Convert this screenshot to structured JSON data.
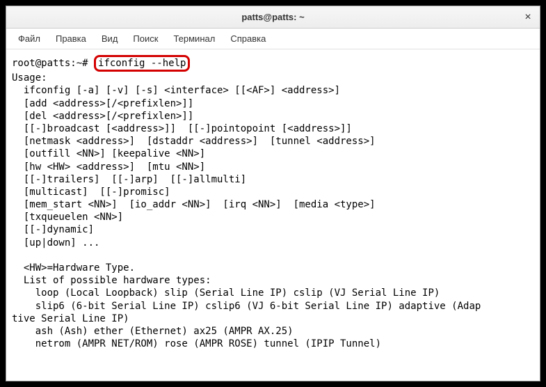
{
  "titlebar": {
    "title": "patts@patts: ~",
    "close_glyph": "×"
  },
  "menubar": {
    "items": [
      {
        "label": "Файл"
      },
      {
        "label": "Правка"
      },
      {
        "label": "Вид"
      },
      {
        "label": "Поиск"
      },
      {
        "label": "Терминал"
      },
      {
        "label": "Справка"
      }
    ]
  },
  "terminal": {
    "prompt": "root@patts:~# ",
    "command": "ifconfig --help",
    "output_lines": [
      "Usage:",
      "  ifconfig [-a] [-v] [-s] <interface> [[<AF>] <address>]",
      "  [add <address>[/<prefixlen>]]",
      "  [del <address>[/<prefixlen>]]",
      "  [[-]broadcast [<address>]]  [[-]pointopoint [<address>]]",
      "  [netmask <address>]  [dstaddr <address>]  [tunnel <address>]",
      "  [outfill <NN>] [keepalive <NN>]",
      "  [hw <HW> <address>]  [mtu <NN>]",
      "  [[-]trailers]  [[-]arp]  [[-]allmulti]",
      "  [multicast]  [[-]promisc]",
      "  [mem_start <NN>]  [io_addr <NN>]  [irq <NN>]  [media <type>]",
      "  [txqueuelen <NN>]",
      "  [[-]dynamic]",
      "  [up|down] ...",
      "",
      "  <HW>=Hardware Type.",
      "  List of possible hardware types:",
      "    loop (Local Loopback) slip (Serial Line IP) cslip (VJ Serial Line IP)",
      "    slip6 (6-bit Serial Line IP) cslip6 (VJ 6-bit Serial Line IP) adaptive (Adap",
      "tive Serial Line IP)",
      "    ash (Ash) ether (Ethernet) ax25 (AMPR AX.25)",
      "    netrom (AMPR NET/ROM) rose (AMPR ROSE) tunnel (IPIP Tunnel)"
    ]
  }
}
